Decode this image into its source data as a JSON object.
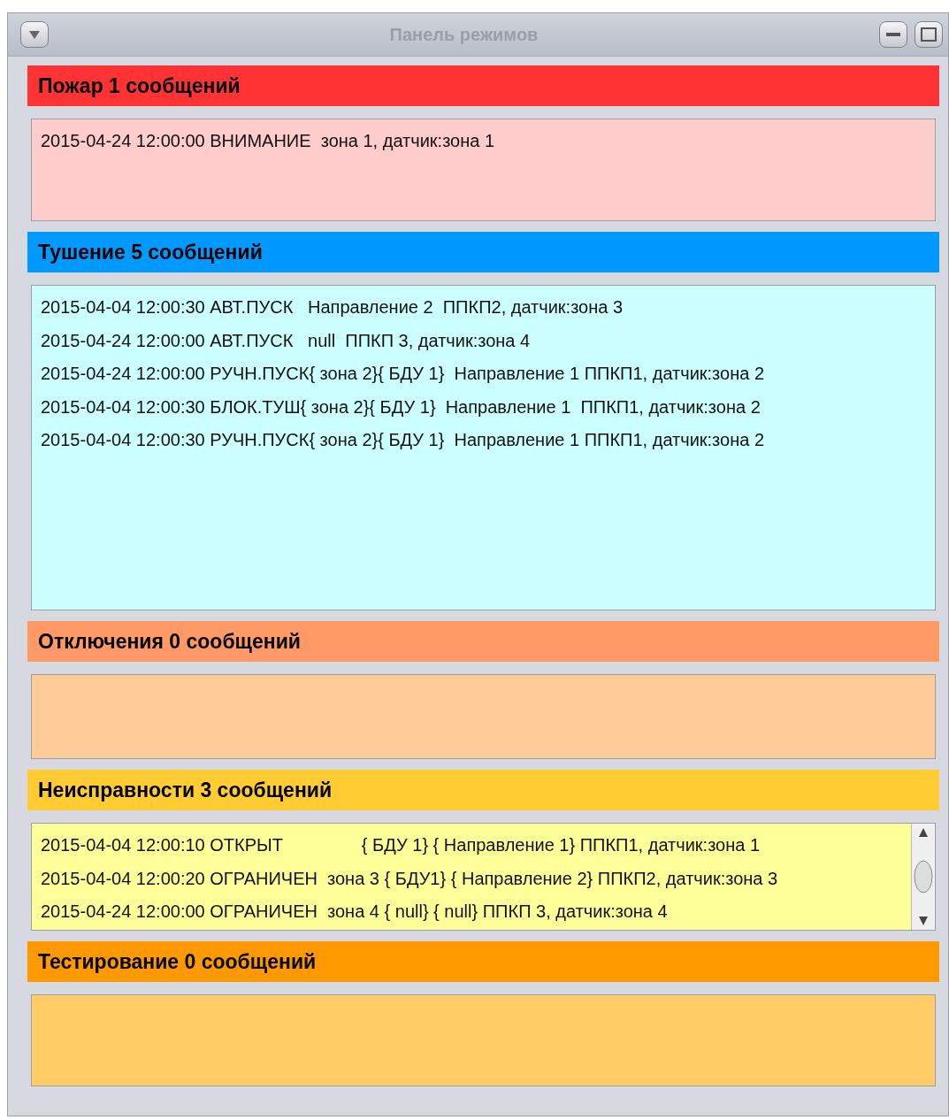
{
  "window": {
    "title": "Панель режимов"
  },
  "sections": [
    {
      "title": "Пожар 1 сообщений",
      "kind": "fire",
      "scrollbar": false,
      "messages": [
        "2015-04-24 12:00:00 ВНИМАНИЕ  зона 1, датчик:зона 1"
      ]
    },
    {
      "title": "Тушение 5 сообщений",
      "kind": "extinguishing",
      "scrollbar": false,
      "messages": [
        "2015-04-04 12:00:30 АВТ.ПУСК   Направление 2  ППКП2, датчик:зона 3",
        "2015-04-24 12:00:00 АВТ.ПУСК   null  ППКП 3, датчик:зона 4",
        "2015-04-24 12:00:00 РУЧН.ПУСК{ зона 2}{ БДУ 1}  Направление 1 ППКП1, датчик:зона 2",
        "2015-04-04 12:00:30 БЛОК.ТУШ{ зона 2}{ БДУ 1}  Направление 1  ППКП1, датчик:зона 2",
        "2015-04-04 12:00:30 РУЧН.ПУСК{ зона 2}{ БДУ 1}  Направление 1 ППКП1, датчик:зона 2"
      ]
    },
    {
      "title": "Отключения 0 сообщений",
      "kind": "disabled",
      "scrollbar": false
    },
    {
      "title": "Неисправности 3 сообщений",
      "kind": "fault",
      "scrollbar": true,
      "messages": [
        "2015-04-04 12:00:10 ОТКРЫТ                { БДУ 1} { Направление 1} ППКП1, датчик:зона 1",
        "2015-04-04 12:00:20 ОГРАНИЧЕН  зона 3 { БДУ1} { Направление 2} ППКП2, датчик:зона 3",
        "2015-04-24 12:00:00 ОГРАНИЧЕН  зона 4 { null} { null} ППКП 3, датчик:зона 4"
      ]
    },
    {
      "title": "Тестирование 0 сообщений",
      "kind": "testing",
      "scrollbar": false
    }
  ]
}
